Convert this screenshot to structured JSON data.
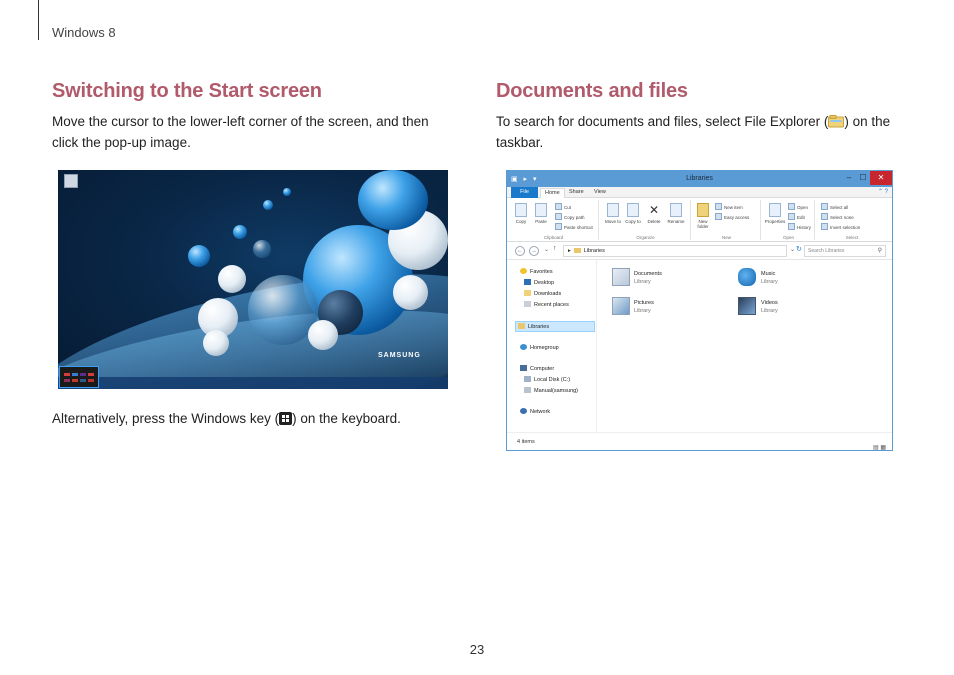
{
  "header": {
    "chapter": "Windows 8"
  },
  "left": {
    "title": "Switching to the Start screen",
    "body_lines": [
      "Move the cursor to the lower-left corner of the screen, and then",
      "click the pop-up image."
    ],
    "screenshot": {
      "brand": "SAMSUNG"
    },
    "alt_before": "Alternatively, press the Windows key (",
    "alt_after": ") on the keyboard."
  },
  "right": {
    "title": "Documents and files",
    "body_line1_before": "To search for documents and files, select File Explorer (",
    "body_line1_after": ") on the",
    "body_line2": "taskbar.",
    "explorer": {
      "window_title": "Libraries",
      "tabs": [
        "File",
        "Home",
        "Share",
        "View"
      ],
      "ribbon": {
        "clipboard": {
          "label": "Clipboard",
          "copy": "Copy",
          "paste": "Paste",
          "cut": "Cut",
          "copy_path": "Copy path",
          "paste_shortcut": "Paste shortcut"
        },
        "organize": {
          "label": "Organize",
          "move_to": "Move to",
          "copy_to": "Copy to",
          "delete": "Delete",
          "rename": "Rename"
        },
        "new": {
          "label": "New",
          "new_folder": "New folder",
          "new_item": "New item",
          "easy_access": "Easy access"
        },
        "open": {
          "label": "Open",
          "properties": "Properties",
          "open": "Open",
          "edit": "Edit",
          "history": "History"
        },
        "select": {
          "label": "Select",
          "select_all": "Select all",
          "select_none": "Select none",
          "invert_selection": "Invert selection"
        }
      },
      "address": "Libraries",
      "search_placeholder": "Search Libraries",
      "nav": {
        "favorites": "Favorites",
        "desktop": "Desktop",
        "downloads": "Downloads",
        "recent_places": "Recent places",
        "libraries": "Libraries",
        "homegroup": "Homegroup",
        "computer": "Computer",
        "local_disk": "Local Disk (C:)",
        "manual": "Manual(samsung)",
        "network": "Network"
      },
      "libraries": [
        {
          "name": "Documents",
          "type": "Library"
        },
        {
          "name": "Music",
          "type": "Library"
        },
        {
          "name": "Pictures",
          "type": "Library"
        },
        {
          "name": "Videos",
          "type": "Library"
        }
      ],
      "status": "4 items"
    }
  },
  "page_number": "23"
}
